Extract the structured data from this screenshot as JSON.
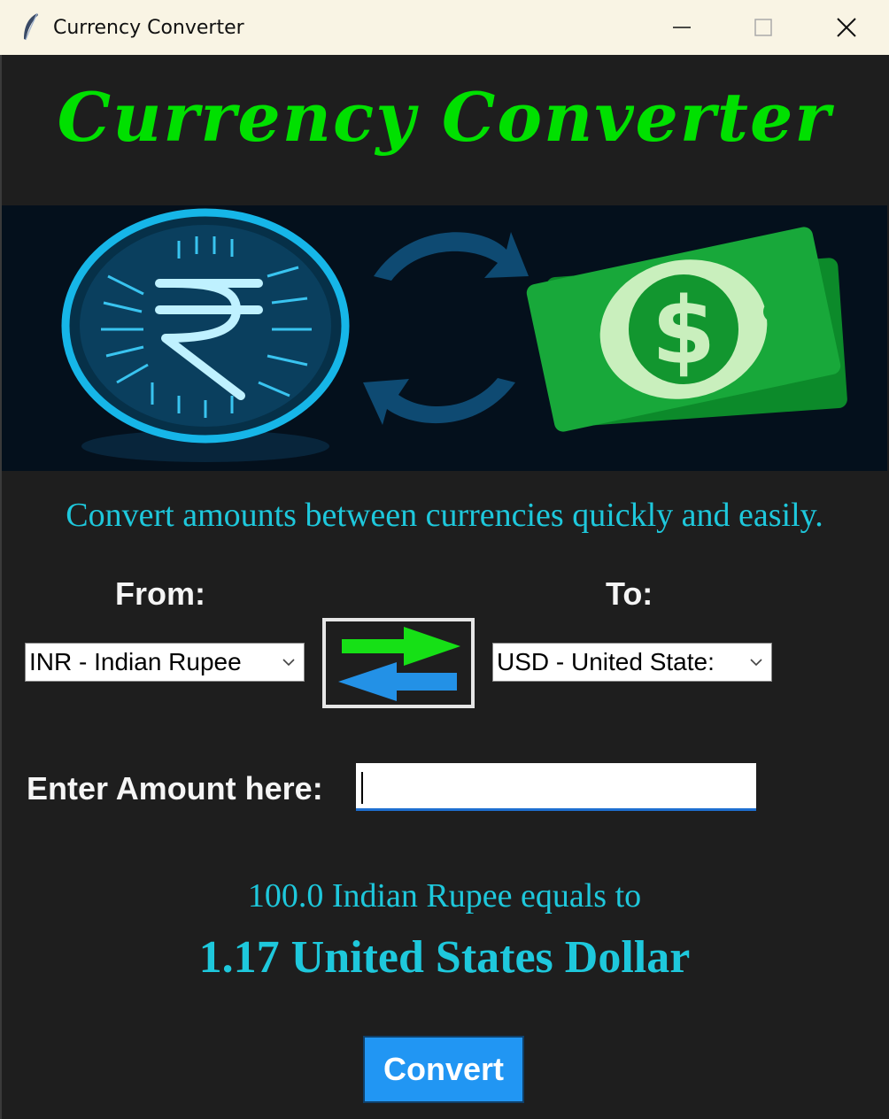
{
  "window": {
    "title": "Currency Converter",
    "controls": [
      "minimize",
      "maximize",
      "close"
    ]
  },
  "header": {
    "title": "Currency Converter",
    "title_color": "#00e000"
  },
  "banner": {
    "icons": [
      "rupee-coin-icon",
      "exchange-arrows-icon",
      "dollar-bills-icon"
    ]
  },
  "subtitle": "Convert amounts between currencies quickly and easily.",
  "from": {
    "label": "From:",
    "selected": "INR - Indian Rupee"
  },
  "to": {
    "label": "To:",
    "selected": "USD - United States Dollar",
    "selected_visible": "USD - United State:"
  },
  "swap": {
    "icon": "swap-arrows-icon"
  },
  "amount": {
    "label": "Enter Amount here:",
    "value": ""
  },
  "result": {
    "line1": "100.0 Indian Rupee equals to",
    "line2": "1.17 United States Dollar"
  },
  "convert_label": "Convert",
  "colors": {
    "accent": "#1ec8dc",
    "button": "#2196f3",
    "background": "#1e1e1e"
  }
}
